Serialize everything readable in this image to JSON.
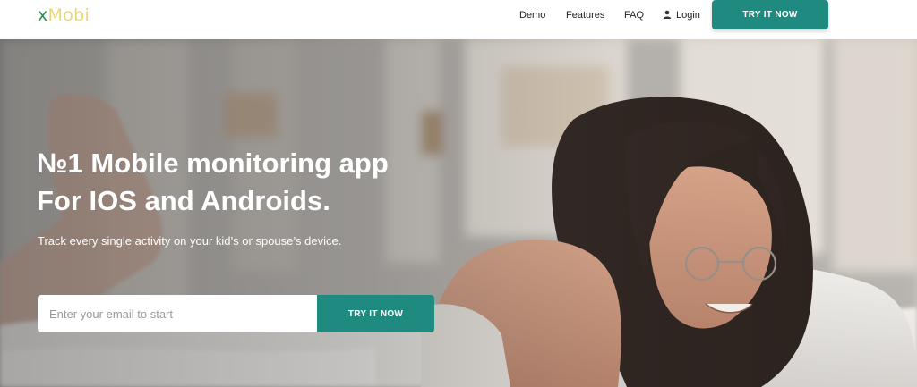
{
  "brand": {
    "logo_prefix": "x",
    "logo_rest": "Mobi",
    "accent": "#1f8a80"
  },
  "nav": {
    "demo": "Demo",
    "features": "Features",
    "faq": "FAQ",
    "login": "Login",
    "cta": "TRY IT NOW"
  },
  "hero": {
    "title_line1": "№1 Mobile monitoring app",
    "title_line2": "For IOS and Androids.",
    "subtitle": "Track every single activity on your kid’s or spouse’s device.",
    "email_placeholder": "Enter your email to start",
    "cta": "TRY IT NOW"
  }
}
